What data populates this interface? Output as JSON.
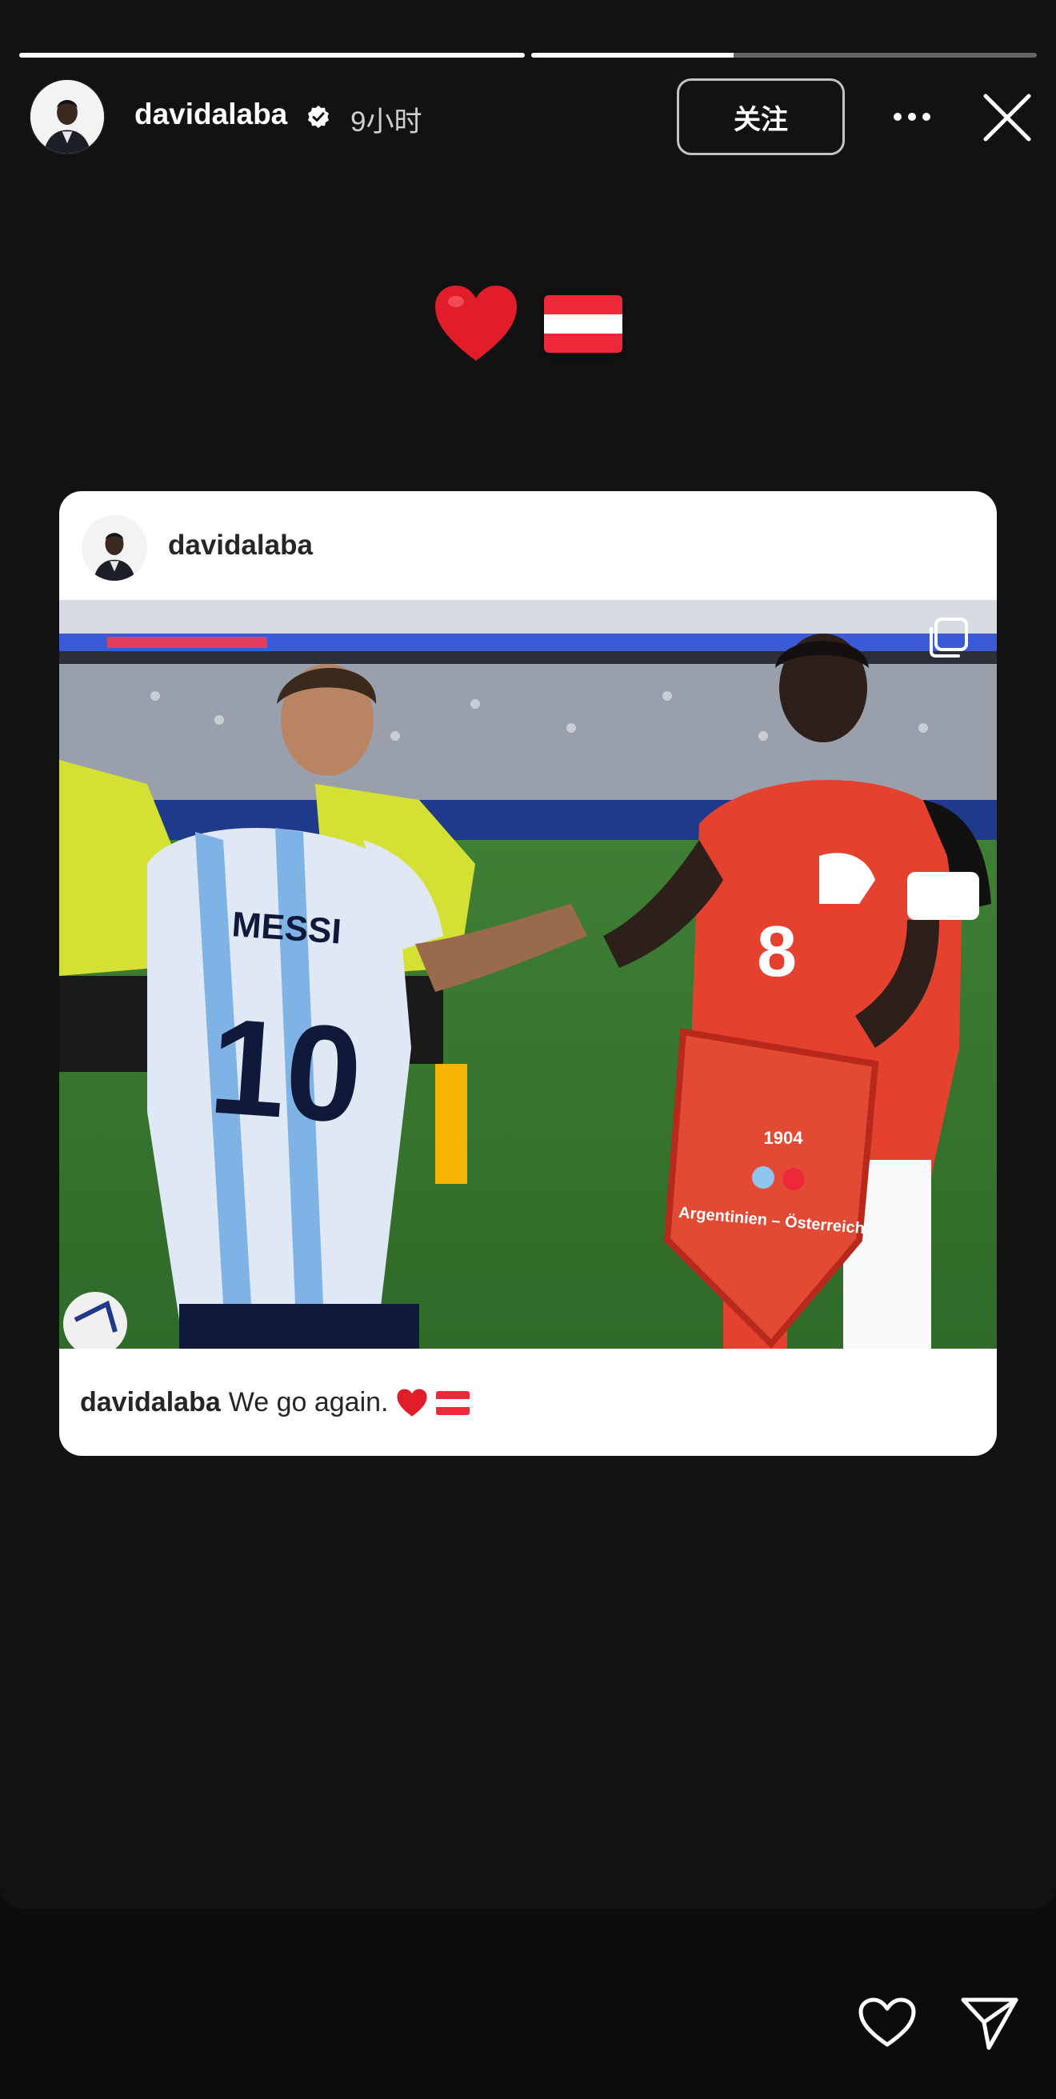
{
  "story": {
    "progress": [
      1.0,
      0.4
    ],
    "user": {
      "username": "davidalaba",
      "verified": true
    },
    "time_ago": "9小时",
    "follow_label": "关注",
    "sticker": {
      "icons": [
        "red-heart-icon",
        "austria-flag-icon"
      ]
    }
  },
  "post": {
    "username": "davidalaba",
    "caption_user": "davidalaba",
    "caption_text": "We go again.",
    "caption_icons": [
      "red-heart-icon",
      "austria-flag-icon"
    ],
    "photo": {
      "left_jersey_name": "MESSI",
      "left_jersey_number": "10",
      "right_jersey_number": "8",
      "pennant_year": "1904",
      "pennant_text": "Argentinien – Österreich"
    }
  },
  "colors": {
    "background": "#121212",
    "heart": "#e11d2a",
    "austria_red": "#ed2939",
    "card_bg": "#ffffff"
  }
}
